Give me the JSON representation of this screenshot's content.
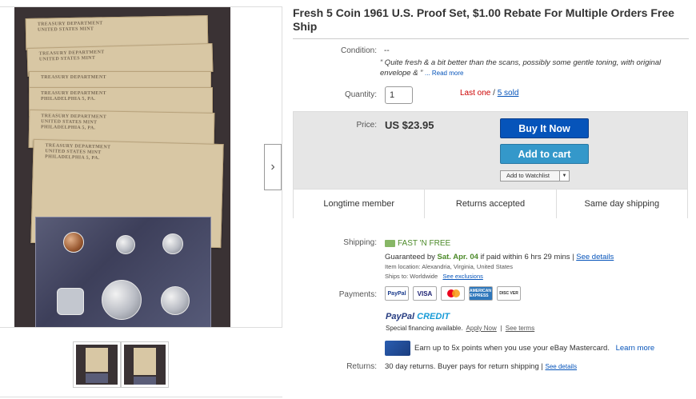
{
  "title": "Fresh 5 Coin 1961 U.S. Proof Set, $1.00 Rebate For Multiple Orders Free Ship",
  "condition": {
    "label": "Condition:",
    "value": "--",
    "quote": "“ Quite fresh & a bit better than the scans, possibly some gentle toning, with original envelope & ”",
    "read_more": "... Read more"
  },
  "quantity": {
    "label": "Quantity:",
    "value": "1",
    "last_one": "Last one",
    "separator": "/",
    "sold": "5 sold"
  },
  "price": {
    "label": "Price:",
    "value": "US $23.95"
  },
  "buttons": {
    "buy_now": "Buy It Now",
    "add_to_cart": "Add to cart",
    "watchlist": "Add to Watchlist",
    "watchlist_dropdown": "▼"
  },
  "features": [
    "Longtime member",
    "Returns accepted",
    "Same day shipping"
  ],
  "shipping": {
    "label": "Shipping:",
    "fast": "FAST 'N FREE",
    "guaranteed_prefix": "Guaranteed by",
    "guaranteed_date": "Sat. Apr. 04",
    "guaranteed_suffix": "if paid within 6 hrs 29 mins |",
    "see_details": "See details",
    "item_location": "Item location:  Alexandria, Virginia, United States",
    "ships_to": "Ships to:  Worldwide",
    "see_exclusions": "See exclusions"
  },
  "payments": {
    "label": "Payments:",
    "icons": [
      {
        "name": "paypal",
        "text": "PayPal"
      },
      {
        "name": "visa",
        "text": "VISA"
      },
      {
        "name": "mastercard",
        "text": ""
      },
      {
        "name": "amex",
        "text": "AMERICAN EXPRESS"
      },
      {
        "name": "discover",
        "text": "DISC VER"
      }
    ],
    "paypal_credit_1": "PayPal",
    "paypal_credit_2": "CREDIT",
    "special_financing": "Special financing available.",
    "apply_now": "Apply Now",
    "see_terms": "See terms",
    "earn": "Earn up to 5x points when you use your eBay Mastercard.",
    "learn_more": "Learn more"
  },
  "returns": {
    "label": "Returns:",
    "text": "30 day returns. Buyer pays for return shipping |",
    "see_details": "See details"
  },
  "gallery": {
    "next_arrow": "›",
    "envelope_label": "TREASURY DEPARTMENT",
    "envelope_sub1": "UNITED STATES MINT",
    "envelope_sub2": "PHILADELPHIA 5, PA."
  }
}
